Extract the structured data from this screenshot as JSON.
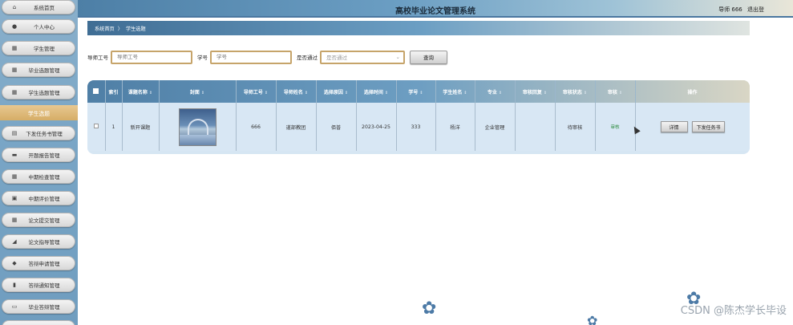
{
  "header": {
    "title": "高校毕业论文管理系统",
    "user": "导师 666",
    "logout": "退出登"
  },
  "sidebar": {
    "items": [
      {
        "label": "系统首页",
        "icon": "home-icon",
        "glyph": "⌂"
      },
      {
        "label": "个人中心",
        "icon": "user-icon",
        "glyph": "●"
      },
      {
        "label": "学生管理",
        "icon": "grid-icon",
        "glyph": "▦"
      },
      {
        "label": "毕业选题管理",
        "icon": "grid-icon",
        "glyph": "▦"
      },
      {
        "label": "学生选题管理",
        "icon": "grid-icon",
        "glyph": "▦"
      },
      {
        "label": "下发任务书管理",
        "icon": "document-icon",
        "glyph": "▤"
      },
      {
        "label": "开题报告管理",
        "icon": "document-icon",
        "glyph": "▬"
      },
      {
        "label": "中期检查管理",
        "icon": "grid-icon",
        "glyph": "▦"
      },
      {
        "label": "中期评价管理",
        "icon": "grid-icon",
        "glyph": "▣"
      },
      {
        "label": "论文提交管理",
        "icon": "grid-icon",
        "glyph": "▦"
      },
      {
        "label": "论文指导管理",
        "icon": "chart-icon",
        "glyph": "◢"
      },
      {
        "label": "答辩申请管理",
        "icon": "shield-icon",
        "glyph": "◆"
      },
      {
        "label": "答辩通知管理",
        "icon": "bar-chart-icon",
        "glyph": "▮"
      },
      {
        "label": "毕业答辩管理",
        "icon": "archive-icon",
        "glyph": "▭"
      }
    ],
    "active_label": "学生选题"
  },
  "breadcrumb": {
    "home": "系统首页",
    "separator": "〉",
    "current": "学生选题"
  },
  "search": {
    "teacher_id_label": "导师工号",
    "teacher_id_placeholder": "导师工号",
    "student_id_label": "学号",
    "student_id_placeholder": "学号",
    "passed_label": "是否通过",
    "passed_placeholder": "是否通过",
    "query_button": "查询"
  },
  "table": {
    "columns": [
      "索引",
      "课题名称",
      "封面",
      "导师工号",
      "导师姓名",
      "选择原因",
      "选择时间",
      "学号",
      "学生姓名",
      "专业",
      "审核回复",
      "审核状态",
      "审核",
      "操作"
    ],
    "rows": [
      {
        "index": "1",
        "topic": "新开课题",
        "teacher_id": "666",
        "teacher_name": "道部教团",
        "reason": "佰普",
        "time": "2023-04-25",
        "student_id": "333",
        "student_name": "杨洋",
        "major": "企业管理",
        "reply": "",
        "status": "待审核",
        "audit": "审核",
        "detail_button": "详情",
        "task_button": "下发任务书"
      }
    ]
  },
  "watermark": "CSDN @陈杰学长毕设"
}
